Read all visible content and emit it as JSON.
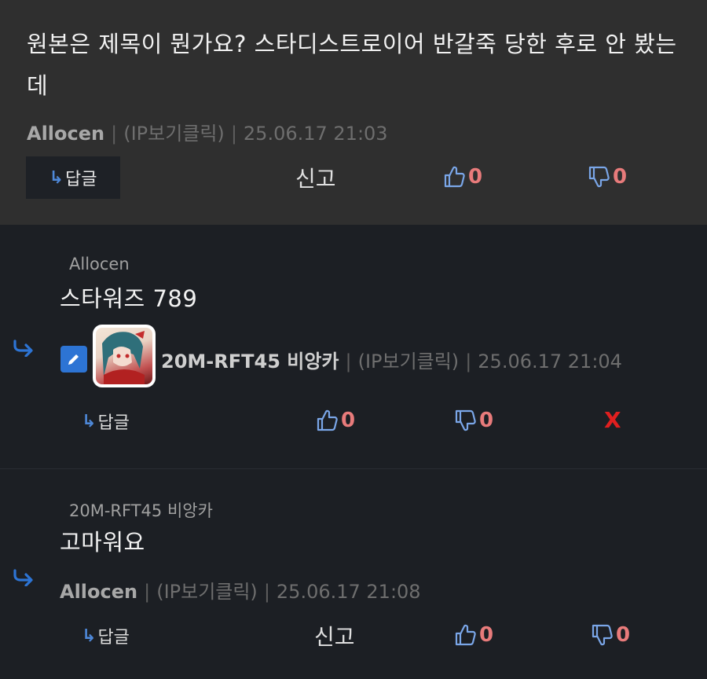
{
  "top_comment": {
    "text": "원본은 제목이 뭔가요? 스타디스트로이어 반갈죽 당한 후로 안 봤는데",
    "author": "Allocen",
    "ip": "(IP보기클릭)",
    "date": "25.06.17 21:03",
    "reply_label": "답글",
    "report_label": "신고",
    "likes": "0",
    "dislikes": "0"
  },
  "reply_1": {
    "quote_author": "Allocen",
    "text": "스타워즈 789",
    "author": "20M-RFT45 비앙카",
    "ip": "(IP보기클릭)",
    "date": "25.06.17 21:04",
    "reply_label": "답글",
    "likes": "0",
    "dislikes": "0",
    "delete_label": "X"
  },
  "reply_2": {
    "quote_author": "20M-RFT45 비앙카",
    "text": "고마워요",
    "author": "Allocen",
    "ip": "(IP보기클릭)",
    "date": "25.06.17 21:08",
    "reply_label": "답글",
    "report_label": "신고",
    "likes": "0",
    "dislikes": "0"
  },
  "icons": {
    "reply_arrow": "reply-arrow-icon",
    "thumbs_up": "thumbs-up-icon",
    "thumbs_down": "thumbs-down-icon",
    "edit": "pencil-icon"
  },
  "colors": {
    "accent_blue": "#2d74d4",
    "vote_count": "#e87b7b",
    "delete": "#e01f1f"
  }
}
